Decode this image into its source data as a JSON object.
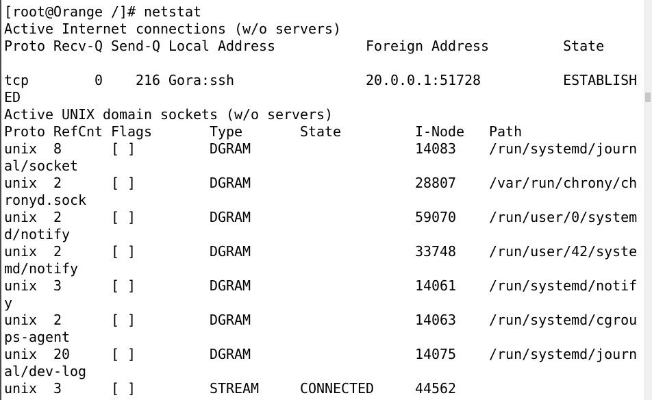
{
  "terminal": {
    "lines": [
      "[root@Orange /]# netstat",
      "Active Internet connections (w/o servers)",
      "Proto Recv-Q Send-Q Local Address           Foreign Address         State",
      "",
      "tcp        0    216 Gora:ssh                20.0.0.1:51728          ESTABLISH",
      "ED",
      "Active UNIX domain sockets (w/o servers)",
      "Proto RefCnt Flags       Type       State         I-Node   Path",
      "unix  8      [ ]         DGRAM                    14083    /run/systemd/journ",
      "al/socket",
      "unix  2      [ ]         DGRAM                    28807    /var/run/chrony/ch",
      "ronyd.sock",
      "unix  2      [ ]         DGRAM                    59070    /run/user/0/system",
      "d/notify",
      "unix  2      [ ]         DGRAM                    33748    /run/user/42/syste",
      "md/notify",
      "unix  3      [ ]         DGRAM                    14061    /run/systemd/notif",
      "y",
      "unix  2      [ ]         DGRAM                    14063    /run/systemd/cgrou",
      "ps-agent",
      "unix  20     [ ]         DGRAM                    14075    /run/systemd/journ",
      "al/dev-log",
      "unix  3      [ ]         STREAM     CONNECTED     44562"
    ]
  }
}
